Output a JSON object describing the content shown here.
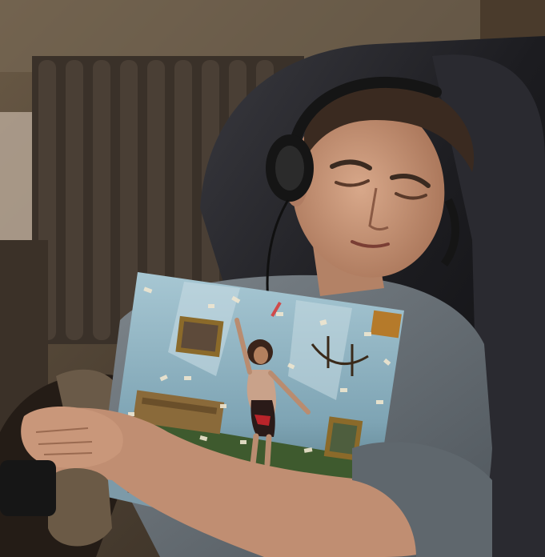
{
  "scene": {
    "subject": "man-in-recliner-with-headphones",
    "held_object": "album-cover",
    "colors": {
      "wall": "#5a4a38",
      "radiator": "#3d342b",
      "chair": "#1c1c20",
      "shirt": "#6b7278",
      "skin": "#c99a7e",
      "hair": "#3a2a20",
      "headphones": "#151515",
      "cover_bg": "#8fb6c6",
      "cover_floor": "#3e5a2e"
    }
  }
}
